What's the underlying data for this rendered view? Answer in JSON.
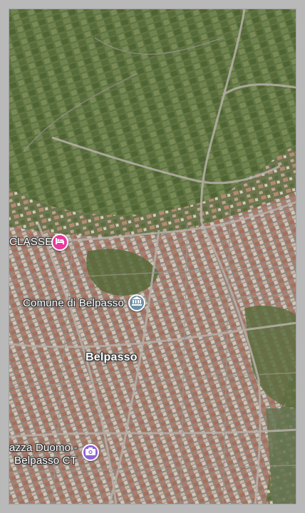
{
  "map": {
    "view": "satellite",
    "places": [
      {
        "id": "hotel",
        "label": "CLASSE",
        "icon": "bed-icon",
        "color": "#e93a9a"
      },
      {
        "id": "townhall",
        "label": "Comune di Belpasso",
        "icon": "government-building-icon",
        "color": "#6b8fa6"
      },
      {
        "id": "town",
        "label": "Belpasso"
      },
      {
        "id": "photo",
        "label_line1": "azza Duomo -",
        "label_line2": "Belpasso CT",
        "icon": "camera-icon",
        "color": "#8f63d6"
      }
    ]
  }
}
